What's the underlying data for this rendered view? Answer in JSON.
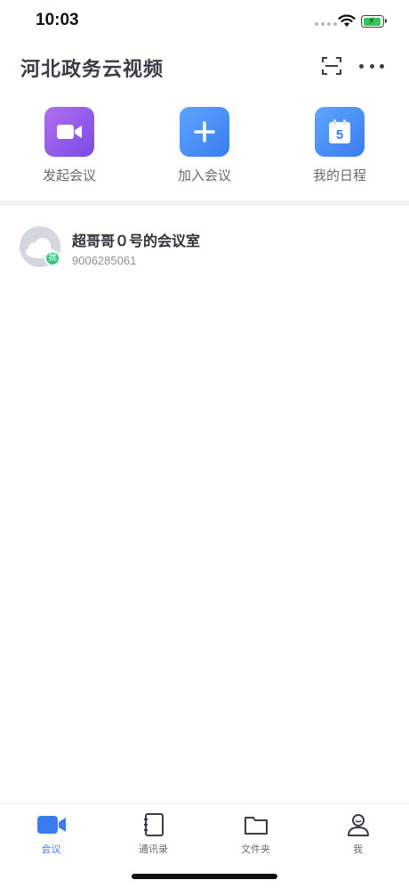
{
  "status_bar": {
    "time": "10:03"
  },
  "header": {
    "title": "河北政务云视频",
    "scan_icon": "scan-icon",
    "more_icon": "more-icon"
  },
  "actions": [
    {
      "label": "发起会议",
      "icon": "video-camera-icon",
      "color": "#8b56ea"
    },
    {
      "label": "加入会议",
      "icon": "plus-icon",
      "color": "#4a8cf6"
    },
    {
      "label": "我的日程",
      "icon": "calendar-icon",
      "color": "#4a8cf6",
      "day": "5"
    }
  ],
  "rooms": [
    {
      "name": "超哥哥０号的会议室",
      "number": "9006285061",
      "badge": "我"
    }
  ],
  "tabs": [
    {
      "label": "会议",
      "icon": "video-camera-icon",
      "active": true
    },
    {
      "label": "通讯录",
      "icon": "contacts-book-icon",
      "active": false
    },
    {
      "label": "文件夹",
      "icon": "folder-icon",
      "active": false
    },
    {
      "label": "我",
      "icon": "person-icon",
      "active": false
    }
  ],
  "colors": {
    "accent": "#3a7cf0",
    "badge": "#34c77d",
    "battery": "#35c759"
  }
}
